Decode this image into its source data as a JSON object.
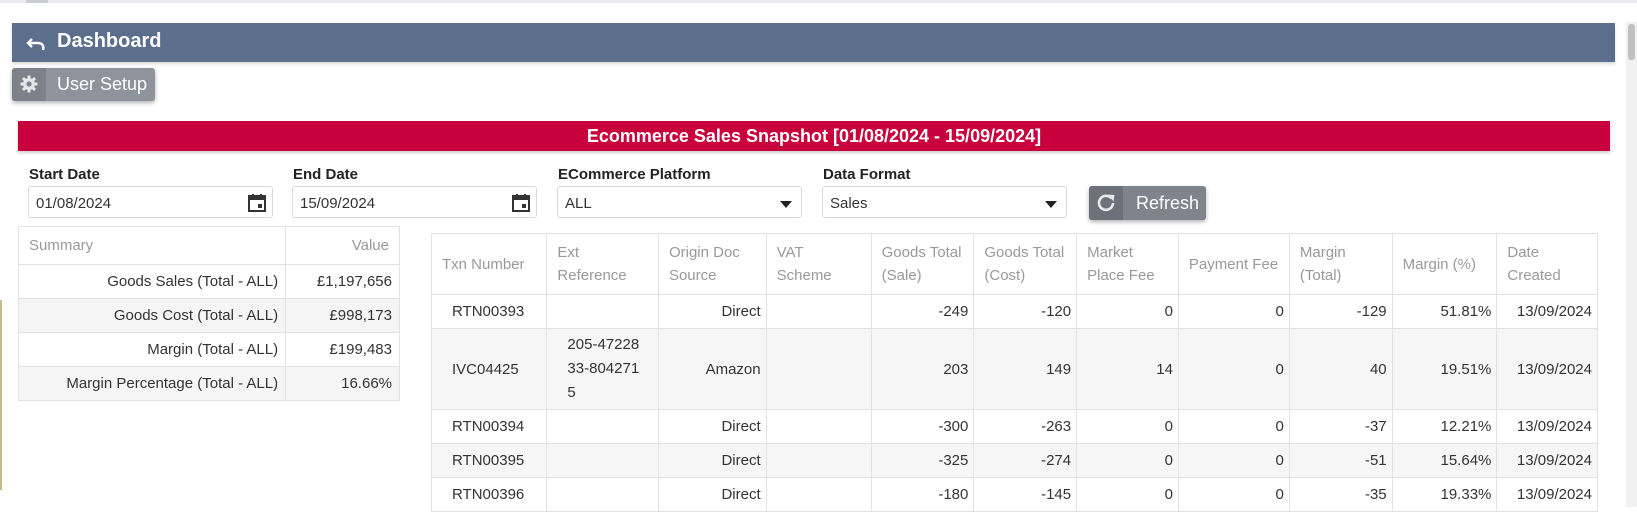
{
  "header": {
    "title": "Dashboard"
  },
  "user_setup": {
    "label": "User Setup"
  },
  "banner": {
    "title": "Ecommerce Sales Snapshot [01/08/2024 - 15/09/2024]"
  },
  "filters": {
    "start_date": {
      "label": "Start Date",
      "value": "01/08/2024"
    },
    "end_date": {
      "label": "End Date",
      "value": "15/09/2024"
    },
    "platform": {
      "label": "ECommerce Platform",
      "value": "ALL"
    },
    "data_format": {
      "label": "Data Format",
      "value": "Sales"
    },
    "refresh_label": "Refresh"
  },
  "summary": {
    "headers": [
      "Summary",
      "Value"
    ],
    "rows": [
      [
        "Goods Sales (Total - ALL)",
        "£1,197,656"
      ],
      [
        "Goods Cost (Total - ALL)",
        "£998,173"
      ],
      [
        "Margin (Total - ALL)",
        "£199,483"
      ],
      [
        "Margin Percentage (Total - ALL)",
        "16.66%"
      ]
    ]
  },
  "transactions": {
    "headers": [
      "Txn Number",
      "Ext Reference",
      "Origin Doc Source",
      "VAT Scheme",
      "Goods Total (Sale)",
      "Goods Total (Cost)",
      "Market Place Fee",
      "Payment Fee",
      "Margin (Total)",
      "Margin (%)",
      "Date Created"
    ],
    "rows": [
      [
        "RTN00393",
        "",
        "Direct",
        "",
        "-249",
        "-120",
        "0",
        "0",
        "-129",
        "51.81%",
        "13/09/2024"
      ],
      [
        "IVC04425",
        "205-4722833-8042715",
        "Amazon",
        "",
        "203",
        "149",
        "14",
        "0",
        "40",
        "19.51%",
        "13/09/2024"
      ],
      [
        "RTN00394",
        "",
        "Direct",
        "",
        "-300",
        "-263",
        "0",
        "0",
        "-37",
        "12.21%",
        "13/09/2024"
      ],
      [
        "RTN00395",
        "",
        "Direct",
        "",
        "-325",
        "-274",
        "0",
        "0",
        "-51",
        "15.64%",
        "13/09/2024"
      ],
      [
        "RTN00396",
        "",
        "Direct",
        "",
        "-180",
        "-145",
        "0",
        "0",
        "-35",
        "19.33%",
        "13/09/2024"
      ]
    ]
  }
}
